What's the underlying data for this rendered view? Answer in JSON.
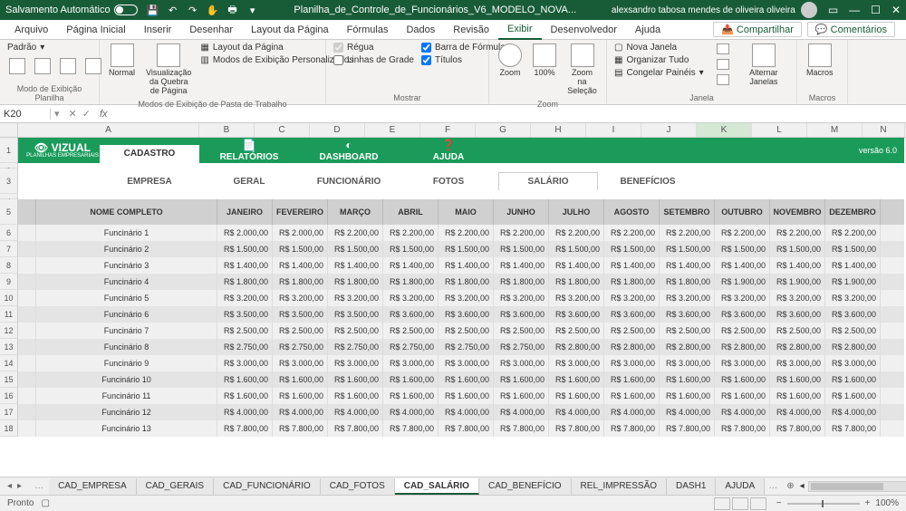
{
  "titlebar": {
    "autosave": "Salvamento Automático",
    "filename": "Planilha_de_Controle_de_Funcionários_V6_MODELO_NOVA...",
    "user": "alexsandro tabosa mendes de oliveira oliveira"
  },
  "ribbon_tabs": [
    "Arquivo",
    "Página Inicial",
    "Inserir",
    "Desenhar",
    "Layout da Página",
    "Fórmulas",
    "Dados",
    "Revisão",
    "Exibir",
    "Desenvolvedor",
    "Ajuda"
  ],
  "ribbon_active": "Exibir",
  "share": "Compartilhar",
  "comments": "Comentários",
  "ribbon": {
    "g1_label": "Modo de Exibição Planilha",
    "g1_padrao": "Padrão",
    "g2_label": "Modos de Exibição de Pasta de Trabalho",
    "g2_normal": "Normal",
    "g2_quebra": "Visualização da Quebra de Página",
    "g2_layout": "Layout da Página",
    "g2_pers": "Modos de Exibição Personalizados",
    "g3_label": "Mostrar",
    "g3_regua": "Régua",
    "g3_grade": "Linhas de Grade",
    "g3_formulas": "Barra de Fórmulas",
    "g3_titulos": "Títulos",
    "g4_label": "Zoom",
    "g4_zoom": "Zoom",
    "g4_100": "100%",
    "g4_sel": "Zoom na Seleção",
    "g5_label": "Janela",
    "g5_nova": "Nova Janela",
    "g5_org": "Organizar Tudo",
    "g5_cong": "Congelar Painéis",
    "g5_alt": "Alternar Janelas",
    "g6_label": "Macros",
    "g6_macros": "Macros"
  },
  "namebox": "K20",
  "col_letters": [
    "A",
    "B",
    "C",
    "D",
    "E",
    "F",
    "G",
    "H",
    "I",
    "J",
    "K",
    "L",
    "M",
    "N"
  ],
  "banner": {
    "brand": "VIZUAL",
    "brand_sub": "PLANILHAS EMPRESARIAIS",
    "nav": [
      "CADASTRO",
      "RELATÓRIOS",
      "DASHBOARD",
      "AJUDA"
    ],
    "version": "versão 6.0"
  },
  "subnav": [
    "EMPRESA",
    "GERAL",
    "FUNCIONÁRIO",
    "FOTOS",
    "SALÁRIO",
    "BENEFÍCIOS"
  ],
  "subnav_active": "SALÁRIO",
  "table": {
    "name_header": "NOME COMPLETO",
    "months": [
      "JANEIRO",
      "FEVEREIRO",
      "MARÇO",
      "ABRIL",
      "MAIO",
      "JUNHO",
      "JULHO",
      "AGOSTO",
      "SETEMBRO",
      "OUTUBRO",
      "NOVEMBRO",
      "DEZEMBRO"
    ],
    "rows": [
      {
        "name": "Funcinário 1",
        "vals": [
          "R$ 2.000,00",
          "R$ 2.000,00",
          "R$ 2.200,00",
          "R$ 2.200,00",
          "R$ 2.200,00",
          "R$ 2.200,00",
          "R$ 2.200,00",
          "R$ 2.200,00",
          "R$ 2.200,00",
          "R$ 2.200,00",
          "R$ 2.200,00",
          "R$ 2.200,00"
        ]
      },
      {
        "name": "Funcinário 2",
        "vals": [
          "R$ 1.500,00",
          "R$ 1.500,00",
          "R$ 1.500,00",
          "R$ 1.500,00",
          "R$ 1.500,00",
          "R$ 1.500,00",
          "R$ 1.500,00",
          "R$ 1.500,00",
          "R$ 1.500,00",
          "R$ 1.500,00",
          "R$ 1.500,00",
          "R$ 1.500,00"
        ]
      },
      {
        "name": "Funcinário 3",
        "vals": [
          "R$ 1.400,00",
          "R$ 1.400,00",
          "R$ 1.400,00",
          "R$ 1.400,00",
          "R$ 1.400,00",
          "R$ 1.400,00",
          "R$ 1.400,00",
          "R$ 1.400,00",
          "R$ 1.400,00",
          "R$ 1.400,00",
          "R$ 1.400,00",
          "R$ 1.400,00"
        ]
      },
      {
        "name": "Funcinário 4",
        "vals": [
          "R$ 1.800,00",
          "R$ 1.800,00",
          "R$ 1.800,00",
          "R$ 1.800,00",
          "R$ 1.800,00",
          "R$ 1.800,00",
          "R$ 1.800,00",
          "R$ 1.800,00",
          "R$ 1.800,00",
          "R$ 1.900,00",
          "R$ 1.900,00",
          "R$ 1.900,00"
        ]
      },
      {
        "name": "Funcinário 5",
        "vals": [
          "R$ 3.200,00",
          "R$ 3.200,00",
          "R$ 3.200,00",
          "R$ 3.200,00",
          "R$ 3.200,00",
          "R$ 3.200,00",
          "R$ 3.200,00",
          "R$ 3.200,00",
          "R$ 3.200,00",
          "R$ 3.200,00",
          "R$ 3.200,00",
          "R$ 3.200,00"
        ]
      },
      {
        "name": "Funcinário 6",
        "vals": [
          "R$ 3.500,00",
          "R$ 3.500,00",
          "R$ 3.500,00",
          "R$ 3.600,00",
          "R$ 3.600,00",
          "R$ 3.600,00",
          "R$ 3.600,00",
          "R$ 3.600,00",
          "R$ 3.600,00",
          "R$ 3.600,00",
          "R$ 3.600,00",
          "R$ 3.600,00"
        ]
      },
      {
        "name": "Funcinário 7",
        "vals": [
          "R$ 2.500,00",
          "R$ 2.500,00",
          "R$ 2.500,00",
          "R$ 2.500,00",
          "R$ 2.500,00",
          "R$ 2.500,00",
          "R$ 2.500,00",
          "R$ 2.500,00",
          "R$ 2.500,00",
          "R$ 2.500,00",
          "R$ 2.500,00",
          "R$ 2.500,00"
        ]
      },
      {
        "name": "Funcinário 8",
        "vals": [
          "R$ 2.750,00",
          "R$ 2.750,00",
          "R$ 2.750,00",
          "R$ 2.750,00",
          "R$ 2.750,00",
          "R$ 2.750,00",
          "R$ 2.800,00",
          "R$ 2.800,00",
          "R$ 2.800,00",
          "R$ 2.800,00",
          "R$ 2.800,00",
          "R$ 2.800,00"
        ]
      },
      {
        "name": "Funcinário 9",
        "vals": [
          "R$ 3.000,00",
          "R$ 3.000,00",
          "R$ 3.000,00",
          "R$ 3.000,00",
          "R$ 3.000,00",
          "R$ 3.000,00",
          "R$ 3.000,00",
          "R$ 3.000,00",
          "R$ 3.000,00",
          "R$ 3.000,00",
          "R$ 3.000,00",
          "R$ 3.000,00"
        ]
      },
      {
        "name": "Funcinário 10",
        "vals": [
          "R$ 1.600,00",
          "R$ 1.600,00",
          "R$ 1.600,00",
          "R$ 1.600,00",
          "R$ 1.600,00",
          "R$ 1.600,00",
          "R$ 1.600,00",
          "R$ 1.600,00",
          "R$ 1.600,00",
          "R$ 1.600,00",
          "R$ 1.600,00",
          "R$ 1.600,00"
        ]
      },
      {
        "name": "Funcinário 11",
        "vals": [
          "R$ 1.600,00",
          "R$ 1.600,00",
          "R$ 1.600,00",
          "R$ 1.600,00",
          "R$ 1.600,00",
          "R$ 1.600,00",
          "R$ 1.600,00",
          "R$ 1.600,00",
          "R$ 1.600,00",
          "R$ 1.600,00",
          "R$ 1.600,00",
          "R$ 1.600,00"
        ]
      },
      {
        "name": "Funcinário 12",
        "vals": [
          "R$ 4.000,00",
          "R$ 4.000,00",
          "R$ 4.000,00",
          "R$ 4.000,00",
          "R$ 4.000,00",
          "R$ 4.000,00",
          "R$ 4.000,00",
          "R$ 4.000,00",
          "R$ 4.000,00",
          "R$ 4.000,00",
          "R$ 4.000,00",
          "R$ 4.000,00"
        ]
      },
      {
        "name": "Funcinário 13",
        "vals": [
          "R$ 7.800,00",
          "R$ 7.800,00",
          "R$ 7.800,00",
          "R$ 7.800,00",
          "R$ 7.800,00",
          "R$ 7.800,00",
          "R$ 7.800,00",
          "R$ 7.800,00",
          "R$ 7.800,00",
          "R$ 7.800,00",
          "R$ 7.800,00",
          "R$ 7.800,00"
        ]
      }
    ]
  },
  "sheets": [
    "CAD_EMPRESA",
    "CAD_GERAIS",
    "CAD_FUNCIONÁRIO",
    "CAD_FOTOS",
    "CAD_SALÁRIO",
    "CAD_BENEFÍCIO",
    "REL_IMPRESSÃO",
    "DASH1",
    "AJUDA"
  ],
  "sheet_active": "CAD_SALÁRIO",
  "status": {
    "ready": "Pronto",
    "zoom": "100%"
  }
}
